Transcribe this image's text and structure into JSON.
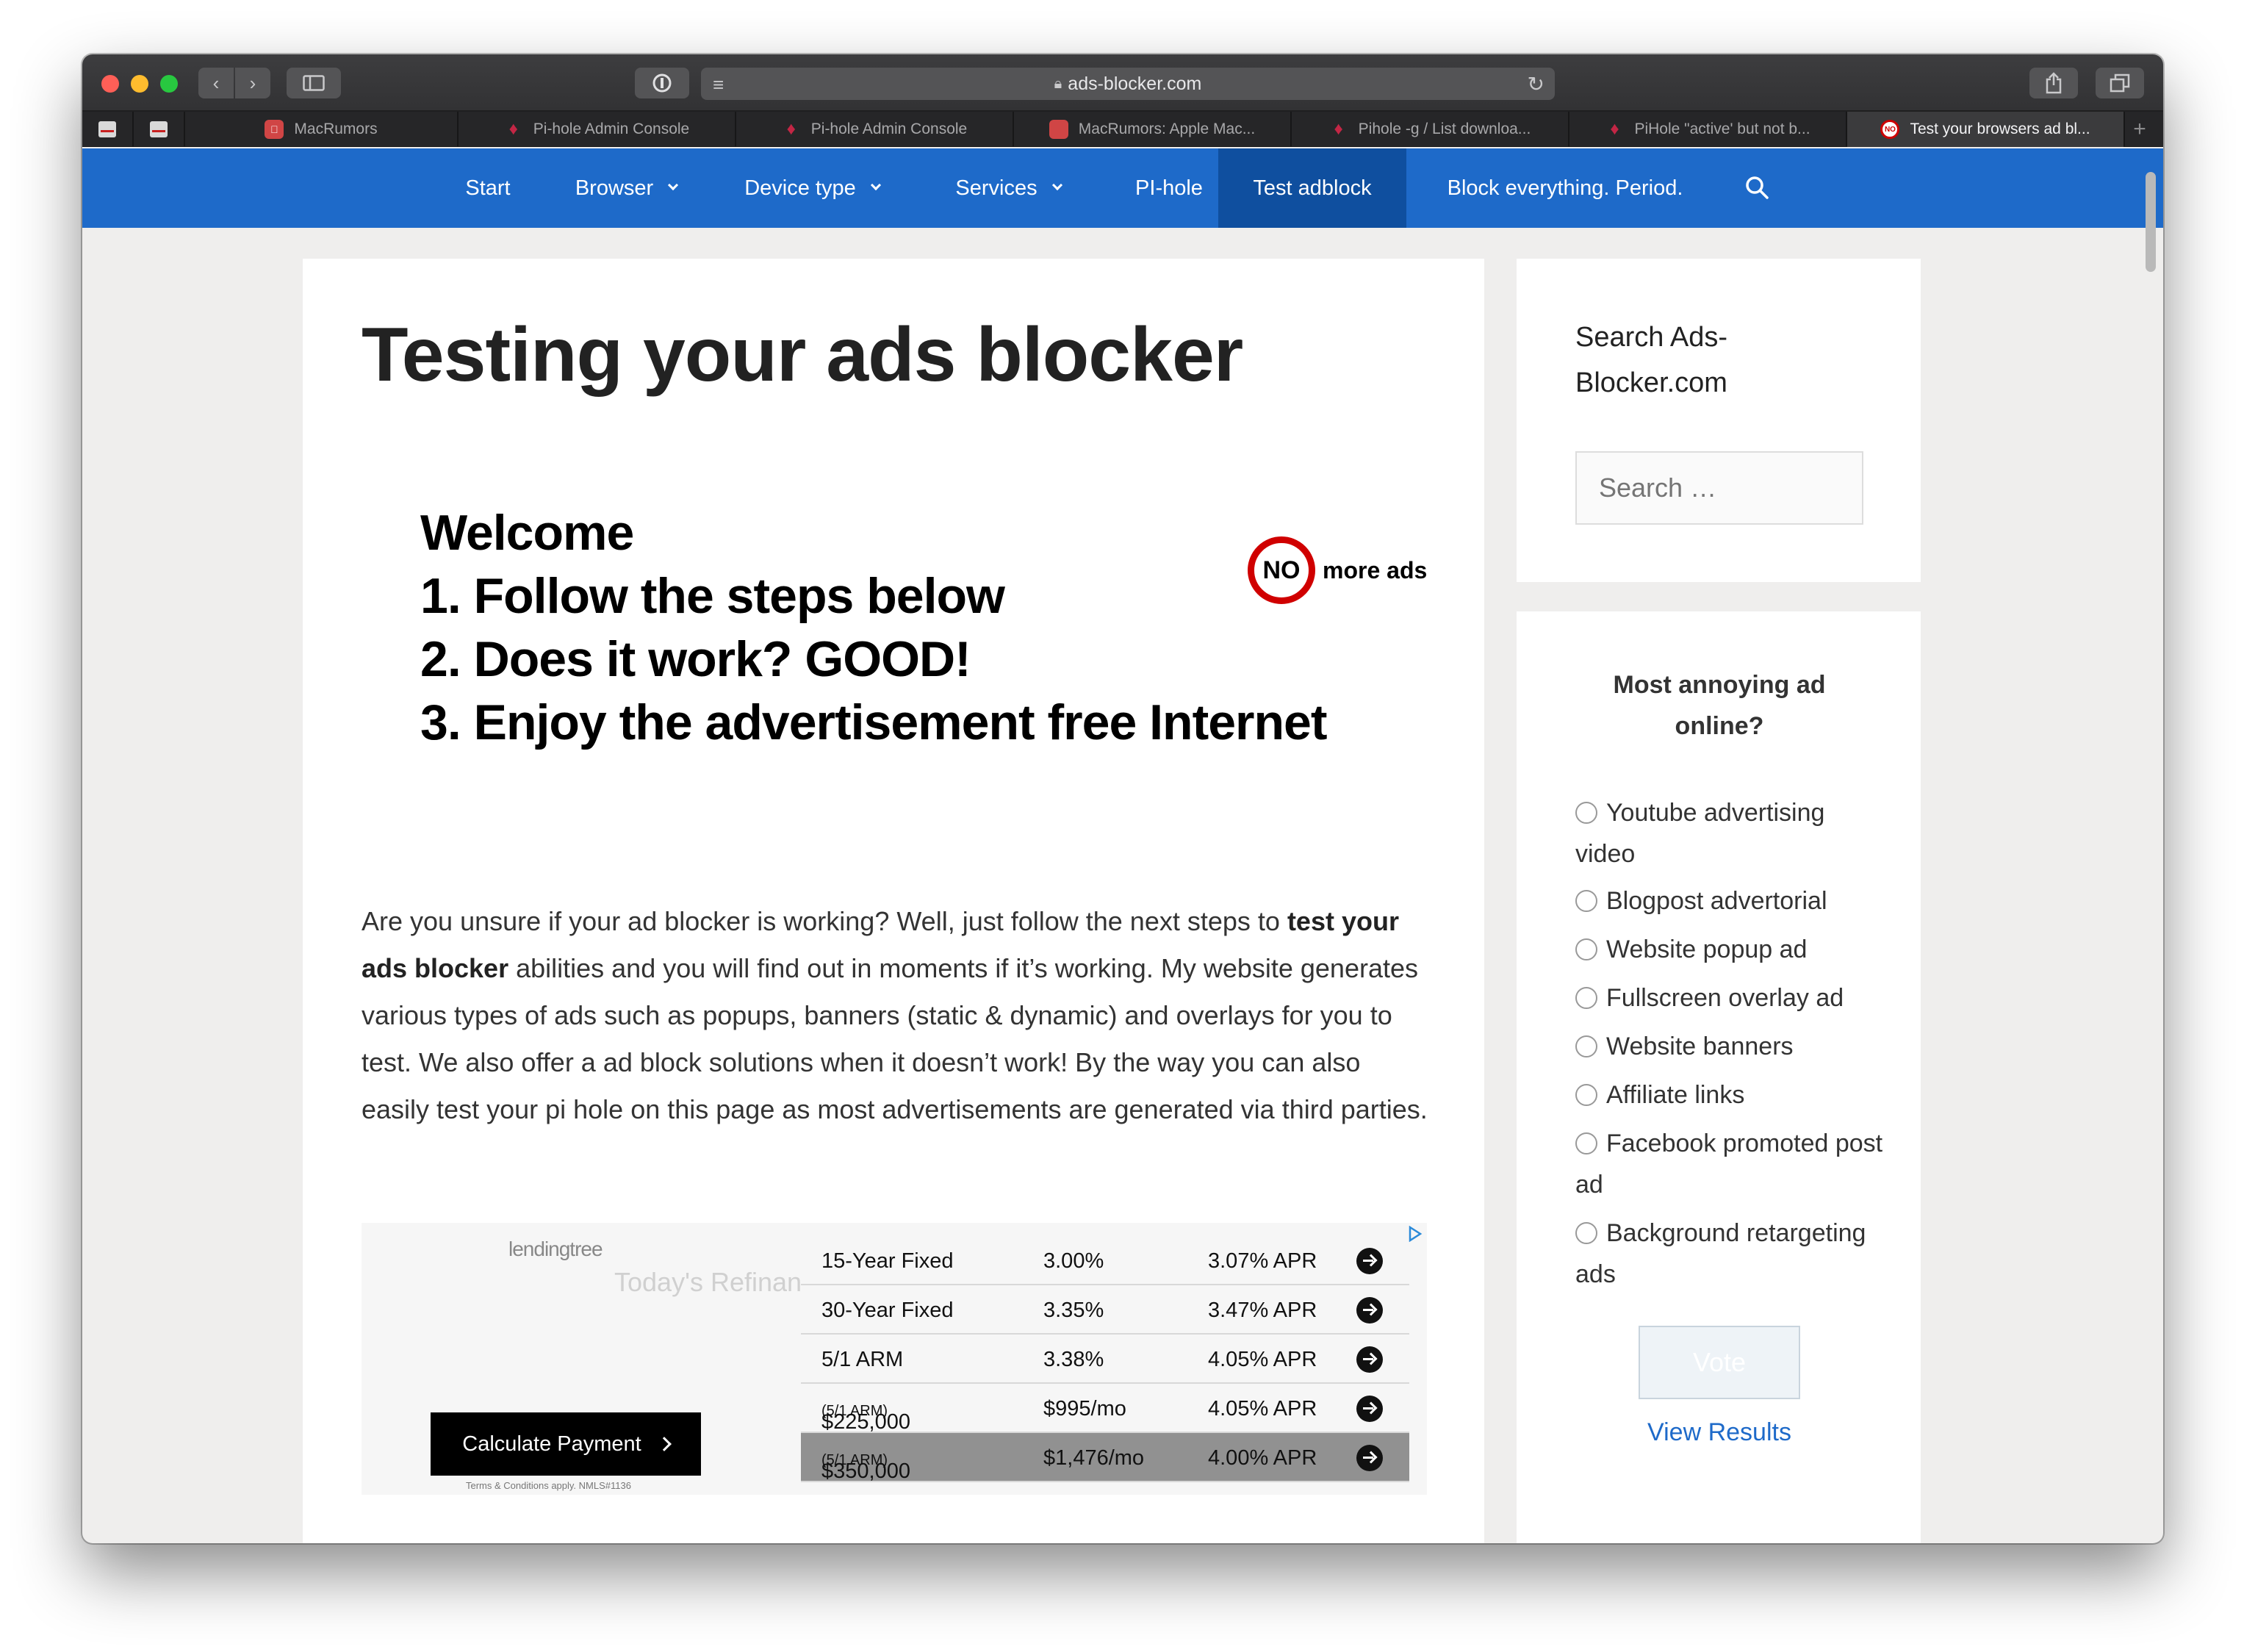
{
  "browser": {
    "url": "ads-blocker.com",
    "tabs": [
      {
        "label": "MacRumors",
        "favicon": "macrumors-icon",
        "active": false
      },
      {
        "label": "Pi-hole Admin Console",
        "favicon": "pihole-icon",
        "active": false
      },
      {
        "label": "Pi-hole Admin Console",
        "favicon": "pihole-icon",
        "active": false
      },
      {
        "label": "MacRumors: Apple Mac...",
        "favicon": "macrumors-icon",
        "active": false
      },
      {
        "label": "Pihole -g / List downloa...",
        "favicon": "pihole-icon",
        "active": false
      },
      {
        "label": "PiHole \"active' but not b...",
        "favicon": "pihole-icon",
        "active": false
      },
      {
        "label": "Test your browsers ad bl...",
        "favicon": "no-ads-icon",
        "active": true
      }
    ]
  },
  "nav": {
    "items": [
      {
        "label": "Start"
      },
      {
        "label": "Browser"
      },
      {
        "label": "Device type"
      },
      {
        "label": "Services"
      },
      {
        "label": "PI-hole"
      },
      {
        "label": "Test adblock"
      },
      {
        "label": "Block everything. Period."
      }
    ]
  },
  "article": {
    "title": "Testing your ads blocker",
    "banner": {
      "lines": [
        "Welcome",
        "1. Follow the steps below",
        "2. Does it work? GOOD!",
        "3. Enjoy the advertisement free Internet"
      ],
      "logo_no": "NO",
      "logo_text": "more ads"
    },
    "intro": {
      "part1": "Are you unsure if your ad blocker is working? Well, just follow the next steps to ",
      "bold": "test your ads blocker",
      "part2": " abilities and you will find out in moments if it’s working. My website generates various types of ads such as popups, banners (static & dynamic) and overlays for you to test. We also offer a ad block solutions when it doesn’t work! By the way you can also easily test your pi hole on this page as most advertisements are generated via third parties."
    }
  },
  "ad": {
    "brand": "lendingtree",
    "headline": "Today's Refinance",
    "button": "Calculate Payment",
    "terms": "Terms & Conditions apply. NMLS#1136",
    "rows": [
      {
        "product": "15-Year Fixed",
        "suffix": "",
        "rate": "3.00%",
        "apr": "3.07% APR"
      },
      {
        "product": "30-Year Fixed",
        "suffix": "",
        "rate": "3.35%",
        "apr": "3.47% APR"
      },
      {
        "product": "5/1 ARM",
        "suffix": "",
        "rate": "3.38%",
        "apr": "4.05% APR"
      },
      {
        "product": "$225,000",
        "suffix": "(5/1 ARM)",
        "rate": "$995/mo",
        "apr": "4.05% APR"
      },
      {
        "product": "$350,000",
        "suffix": "(5/1 ARM)",
        "rate": "$1,476/mo",
        "apr": "4.00% APR"
      }
    ]
  },
  "sidebar": {
    "search_title": "Search Ads-Blocker.com",
    "search_placeholder": "Search …",
    "poll": {
      "question": "Most annoying ad online?",
      "options": [
        "Youtube advertising video",
        "Blogpost advertorial",
        "Website popup ad",
        "Fullscreen overlay ad",
        "Website banners",
        "Affiliate links",
        "Facebook promoted post ad",
        "Background retargeting ads"
      ],
      "vote_label": "Vote",
      "results_label": "View Results"
    }
  },
  "colors": {
    "nav_blue": "#1e6ac9",
    "nav_active": "#0f4f9f",
    "no_ads_red": "#d00000"
  }
}
